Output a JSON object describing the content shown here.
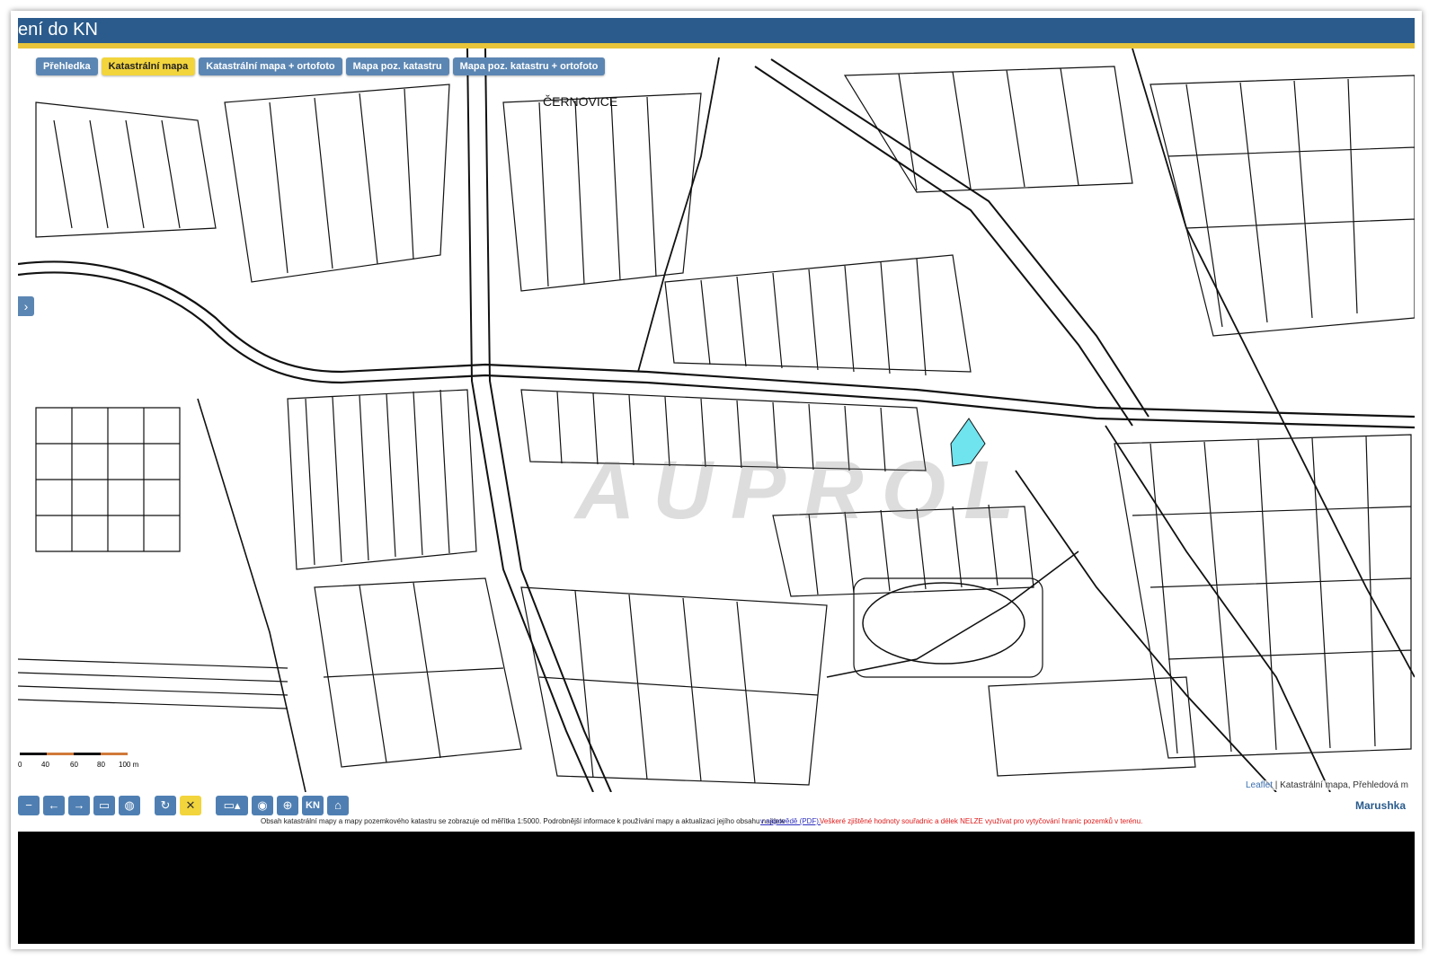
{
  "title": "ení do KN",
  "tabs": [
    {
      "label": "Přehledka",
      "active": false
    },
    {
      "label": "Katastrální mapa",
      "active": true
    },
    {
      "label": "Katastrální mapa + ortofoto",
      "active": false
    },
    {
      "label": "Mapa poz. katastru",
      "active": false
    },
    {
      "label": "Mapa poz. katastru + ortofoto",
      "active": false
    }
  ],
  "map": {
    "place_label": "ČERNOVICE",
    "watermark": "AUPROL",
    "highlight_color": "#6fe3ee",
    "scale_ticks": [
      "0",
      "40",
      "60",
      "80",
      "100 m"
    ],
    "attribution_link": "Leaflet",
    "attribution_text": "| Katastrální mapa, Přehledová m"
  },
  "toolbar": {
    "icons": [
      "zoom-out-icon",
      "arrow-left-icon",
      "arrow-right-icon",
      "zoom-box-icon",
      "globe-icon",
      "refresh-icon",
      "close-icon",
      "measure-icon",
      "location-pin-icon",
      "target-icon",
      "kn-icon",
      "label-icon"
    ],
    "kn_label": "KN",
    "brand": "Marushka"
  },
  "notice": {
    "text": "Obsah katastrální mapy a mapy pozemkového katastru se zobrazuje od měřítka 1:5000. Podrobnější informace k používání mapy a aktualizaci jejího obsahu najdete",
    "link": "v nápovědě (PDF).",
    "warning": "Veškeré zjištěné hodnoty souřadnic a délek NELZE využívat pro vytyčování hranic pozemků v terénu."
  }
}
